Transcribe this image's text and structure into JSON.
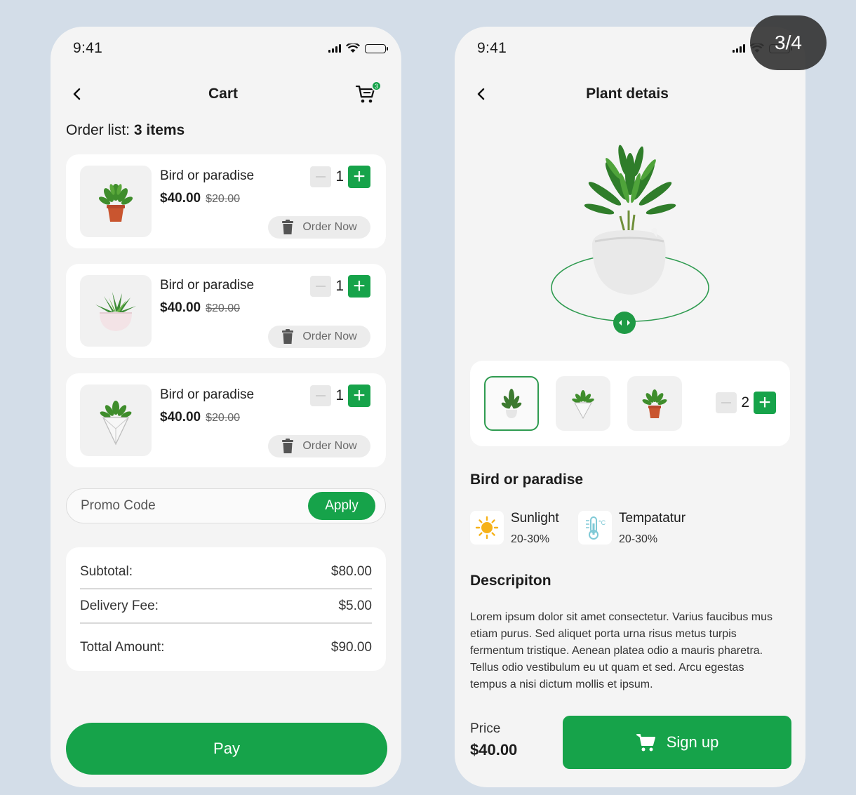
{
  "cart_screen": {
    "status": {
      "time": "9:41"
    },
    "title": "Cart",
    "cart_badge_count": "3",
    "order_list": {
      "label": "Order list:",
      "count": "3 items"
    },
    "items": [
      {
        "name": "Bird or paradise",
        "price": "$40.00",
        "old_price": "$20.00",
        "qty": "1",
        "order_label": "Order Now",
        "image": "potted-plant-terracotta-icon"
      },
      {
        "name": "Bird or paradise",
        "price": "$40.00",
        "old_price": "$20.00",
        "qty": "1",
        "order_label": "Order Now",
        "image": "succulent-pink-pot-icon"
      },
      {
        "name": "Bird or paradise",
        "price": "$40.00",
        "old_price": "$20.00",
        "qty": "1",
        "order_label": "Order Now",
        "image": "geometric-hanging-planter-icon"
      }
    ],
    "promo": {
      "placeholder": "Promo Code",
      "apply_label": "Apply"
    },
    "summary": {
      "subtotal_label": "Subtotal:",
      "subtotal_value": "$80.00",
      "delivery_label": "Delivery Fee:",
      "delivery_value": "$5.00",
      "total_label": "Tottal Amount:",
      "total_value": "$90.00"
    },
    "pay_label": "Pay"
  },
  "detail_screen": {
    "status": {
      "time": "9:41"
    },
    "title": "Plant detais",
    "selected_qty": "2",
    "plant_name": "Bird or paradise",
    "conditions": [
      {
        "name": "Sunlight",
        "value": "20-30%",
        "icon": "sun-icon"
      },
      {
        "name": "Tempatatur",
        "value": "20-30%",
        "icon": "thermometer-icon"
      }
    ],
    "description_title": "Descripiton",
    "description": "Lorem ipsum dolor sit amet consectetur. Varius faucibus mus etiam purus. Sed aliquet porta urna risus metus turpis fermentum tristique. Aenean platea odio a mauris pharetra. Tellus odio vestibulum eu ut quam et sed. Arcu egestas tempus a nisi dictum mollis et ipsum.",
    "price_label": "Price",
    "price_value": "$40.00",
    "signup_label": "Sign up"
  },
  "page_indicator": "3/4",
  "colors": {
    "accent": "#16a34a",
    "background": "#d3dde8",
    "card": "#ffffff",
    "screen": "#f4f4f4"
  }
}
